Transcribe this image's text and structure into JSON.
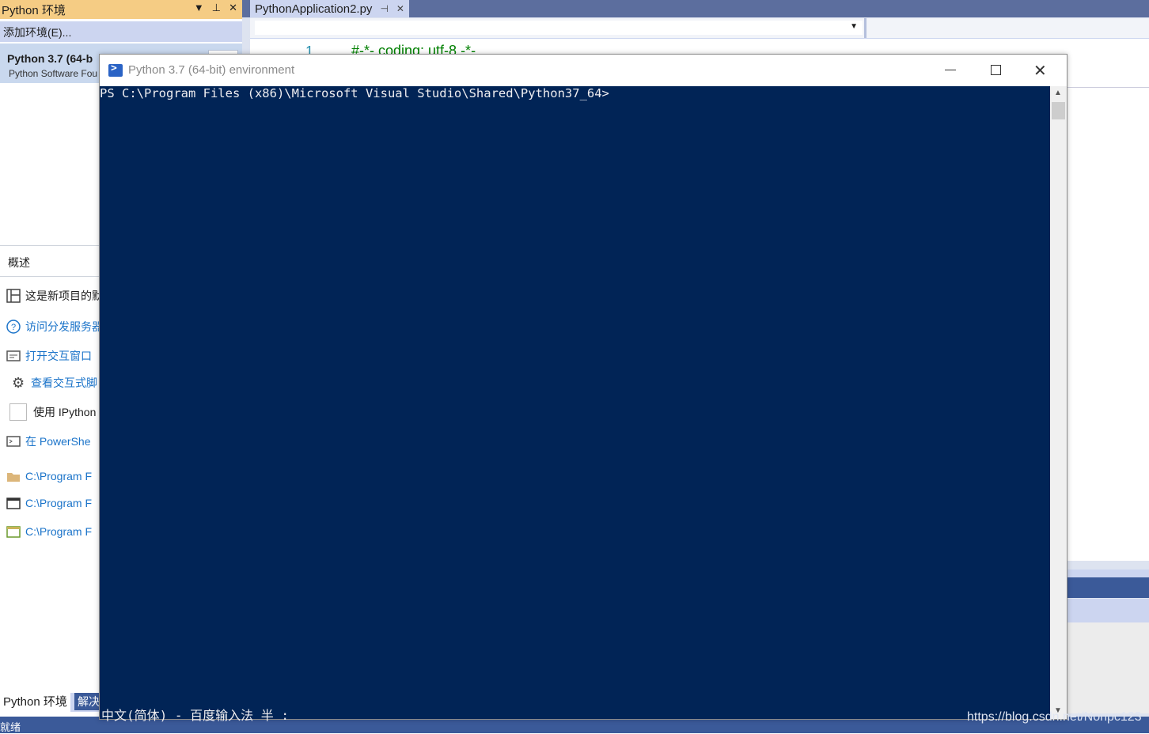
{
  "left_panel": {
    "title": "Python 环境",
    "title_buttons": [
      "▼",
      "⊥",
      "✕"
    ],
    "add_env": "添加环境(E)...",
    "env_name": "Python 3.7 (64-b",
    "env_sub": "Python Software Fou",
    "overview_tab": "概述",
    "rows": [
      {
        "icon": "table-icon",
        "label": "这是新项目的默"
      },
      {
        "icon": "help-icon",
        "label": "访问分发服务器"
      },
      {
        "icon": "interactive-window-icon",
        "label": "打开交互窗口"
      },
      {
        "icon": "gear-icon",
        "label": "查看交互式脚"
      },
      {
        "icon": "checkbox",
        "label": "使用 IPython"
      },
      {
        "icon": "powershell-icon",
        "label": "在 PowerShe"
      },
      {
        "icon": "folder-icon",
        "label": "C:\\Program F"
      },
      {
        "icon": "window-icon",
        "label": "C:\\Program F"
      },
      {
        "icon": "window-green-icon",
        "label": "C:\\Program F"
      }
    ],
    "bottom_tabs": [
      "Python 环境",
      "解决"
    ]
  },
  "editor": {
    "tab_name": "PythonApplication2.py",
    "line_number": "1",
    "code": "#-*- coding: utf-8 -*-"
  },
  "status_bar": {
    "text": "就绪"
  },
  "powershell": {
    "title": "Python 3.7 (64-bit) environment",
    "prompt": "PS C:\\Program Files (x86)\\Microsoft Visual Studio\\Shared\\Python37_64>",
    "ime_status": "中文(简体) - 百度输入法 半 :"
  },
  "watermark": "https://blog.csdn.net/Nonpc123",
  "colors": {
    "console_bg": "#012456",
    "vs_title_active": "#f5cc84",
    "vs_blue": "#3b5a99",
    "link": "#1a73c9"
  }
}
